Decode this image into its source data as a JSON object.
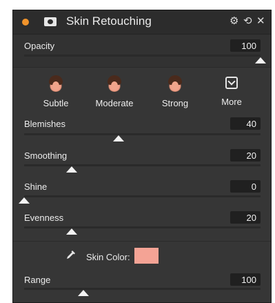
{
  "header": {
    "title": "Skin Retouching",
    "status_dot_color": "#f0932b",
    "icons": [
      "mask-icon",
      "gear-icon",
      "reset-icon",
      "close-icon"
    ]
  },
  "opacity": {
    "label": "Opacity",
    "value": "100",
    "level": 1.0
  },
  "presets": [
    {
      "label": "Subtle",
      "icon": "face-icon"
    },
    {
      "label": "Moderate",
      "icon": "face-icon"
    },
    {
      "label": "Strong",
      "icon": "face-icon"
    },
    {
      "label": "More",
      "icon": "chevron-down-box-icon"
    }
  ],
  "sliders": [
    {
      "label": "Blemishes",
      "value": "40",
      "level": 0.4
    },
    {
      "label": "Smoothing",
      "value": "20",
      "level": 0.2
    },
    {
      "label": "Shine",
      "value": "0",
      "level": 0.0
    },
    {
      "label": "Evenness",
      "value": "20",
      "level": 0.2
    }
  ],
  "skin_color": {
    "label": "Skin Color:",
    "color": "#f4a395"
  },
  "range": {
    "label": "Range",
    "value": "100",
    "level": 0.25
  }
}
